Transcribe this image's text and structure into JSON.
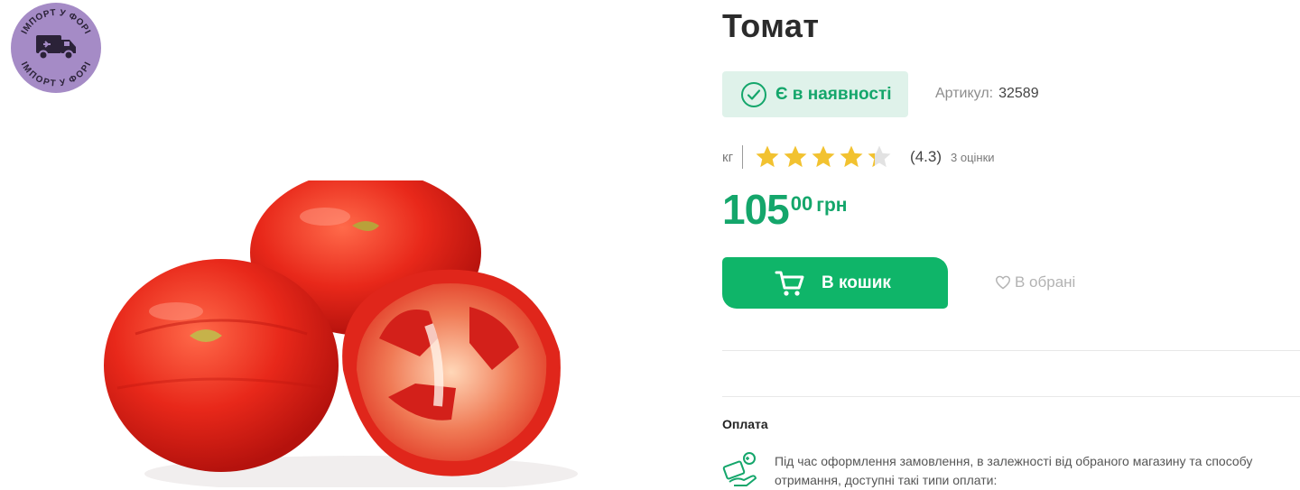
{
  "badge": {
    "text": "ІМПОРТ У ФОРІ",
    "icon": "truck-icon"
  },
  "product": {
    "title": "Томат",
    "stock_label": "Є в наявності",
    "sku_label": "Артикул:",
    "sku_value": "32589",
    "unit": "кг",
    "rating": 4.3,
    "rating_text": "(4.3)",
    "rating_count": "3 оцінки",
    "price_main": "105",
    "price_cents": "00",
    "currency": "грн"
  },
  "actions": {
    "cart_label": "В кошик",
    "favorite_label": "В обрані"
  },
  "payment": {
    "title": "Оплата",
    "description": "Під час оформлення замовлення, в залежності від обраного магазину та способу отримання, доступні такі типи оплати:"
  },
  "colors": {
    "accent": "#0fb569",
    "stock_bg": "#dff2ea",
    "star": "#f2c230",
    "badge": "#a58bc6"
  }
}
